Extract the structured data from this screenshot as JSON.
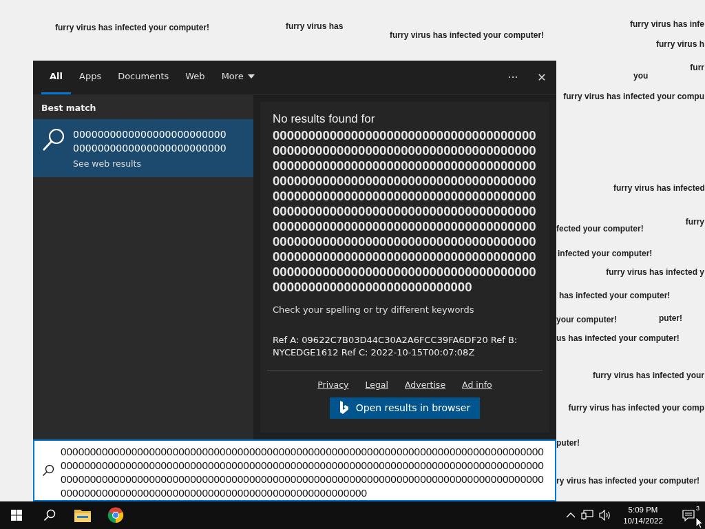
{
  "background_messages": [
    {
      "text": "furry virus has infected your computer!"
    },
    {
      "text": "furry virus has"
    },
    {
      "text": "furry virus has infected your computer!"
    },
    {
      "text": "furry virus has infe"
    },
    {
      "text": "furry virus h"
    },
    {
      "text": "furr"
    },
    {
      "text": "you"
    },
    {
      "text": "furry virus has infected your compu"
    },
    {
      "text": "furry virus has infected"
    },
    {
      "text": "furry"
    },
    {
      "text": "fected your computer!"
    },
    {
      "text": "infected your computer!"
    },
    {
      "text": "furry virus has infected y"
    },
    {
      "text": "has infected your computer!"
    },
    {
      "text": "your computer!"
    },
    {
      "text": "puter!"
    },
    {
      "text": "us has infected your computer!"
    },
    {
      "text": "furry virus has infected your"
    },
    {
      "text": "furry virus has infected your comp"
    },
    {
      "text": "puter!"
    },
    {
      "text": "ry virus has infected your computer!"
    }
  ],
  "search_panel": {
    "tabs": [
      {
        "label": "All",
        "selected": true
      },
      {
        "label": "Apps",
        "selected": false
      },
      {
        "label": "Documents",
        "selected": false
      },
      {
        "label": "Web",
        "selected": false
      },
      {
        "label": "More",
        "selected": false
      }
    ],
    "more_options": "···",
    "close": "✕",
    "best_match": {
      "heading": "Best match",
      "title": "00000000000000000000000000000000000000000000000000",
      "subtitle": "See web results",
      "selected": true
    },
    "results": {
      "heading": "No results found for",
      "query": "00000000000000000000000000000000000000000000000000000000000000000000000000000000000000000000000000000000000000000000000000000000000000000000000000000000000000000000000000000000000000000000000000000000000000000000000000000000000000000000000000000000000000000000000000000000000000000000000000000000000000000000000000000000000000000000000000000000000000000000000000000000000000000000000000000000000000",
      "hint": "Check your spelling or try different keywords",
      "reference": "Ref A: 09622C7B03D44C30A2A6FCC39FA6DF20 Ref B: NYCEDGE1612 Ref C: 2022-10-15T00:07:08Z",
      "links": [
        "Privacy",
        "Legal",
        "Advertise",
        "Ad info"
      ],
      "open_button": "Open results in browser"
    },
    "search_box": {
      "value": "0000000000000000000000000000000000000000000000000000000000000000000000000000000000000000000000000000000000000000000000000000000000000000000000000000000000000000000000000000000000000000000000000000000000000000000000000000000000000000000000000000000000000000000000000000000000000000000000000000000000"
    }
  },
  "taskbar": {
    "time": "5:09 PM",
    "date": "10/14/2022",
    "notification_count": "3"
  }
}
